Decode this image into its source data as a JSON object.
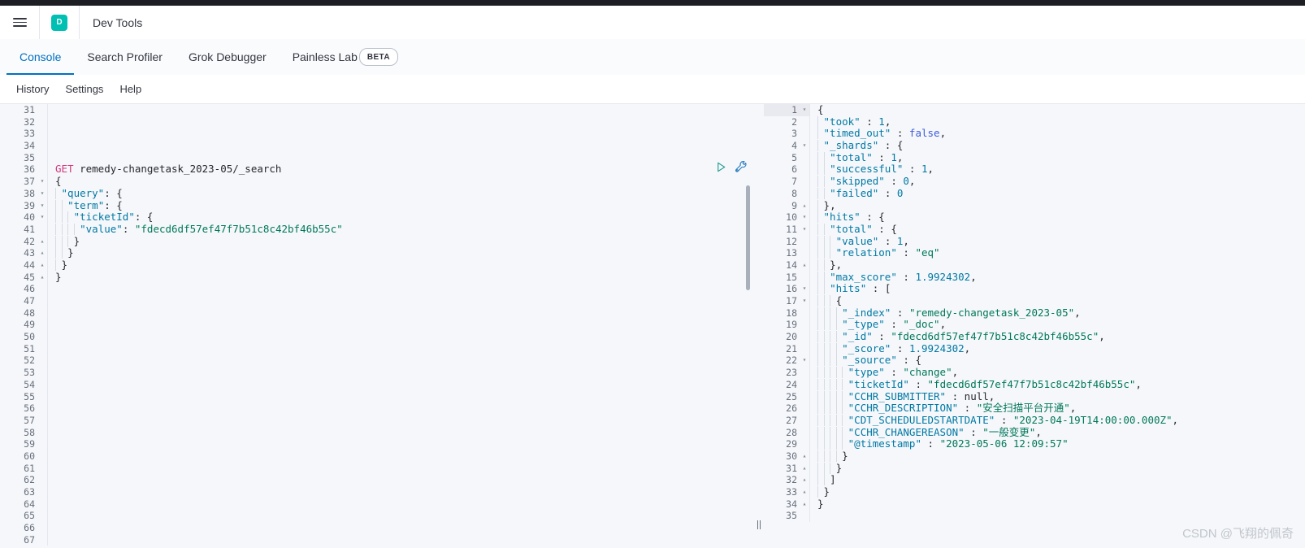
{
  "window": {
    "title": "Dev Tools",
    "logo_letter": "D",
    "logo_color": "#00bfb3",
    "accent_color": "#0071c2"
  },
  "header": {
    "menu_icon": "hamburger-icon"
  },
  "tabs": [
    {
      "label": "Console",
      "active": true
    },
    {
      "label": "Search Profiler",
      "active": false
    },
    {
      "label": "Grok Debugger",
      "active": false
    },
    {
      "label": "Painless Lab",
      "active": false,
      "badge": "BETA"
    }
  ],
  "subnav": [
    {
      "label": "History"
    },
    {
      "label": "Settings"
    },
    {
      "label": "Help"
    }
  ],
  "actions": {
    "send_request": "play-icon",
    "wrench": "wrench-icon"
  },
  "editor": {
    "first_visible_line": 31,
    "last_visible_line": 67,
    "request_line": 36,
    "lines": [
      {
        "n": 31,
        "fold": "",
        "tokens": []
      },
      {
        "n": 32,
        "fold": "",
        "tokens": []
      },
      {
        "n": 33,
        "fold": "",
        "tokens": []
      },
      {
        "n": 34,
        "fold": "",
        "tokens": []
      },
      {
        "n": 35,
        "fold": "",
        "tokens": []
      },
      {
        "n": 36,
        "fold": "",
        "text": "GET remedy-changetask_2023-05/_search"
      },
      {
        "n": 37,
        "fold": "▾",
        "text": "{"
      },
      {
        "n": 38,
        "fold": "▾",
        "text": "  \"query\": {"
      },
      {
        "n": 39,
        "fold": "▾",
        "text": "    \"term\": {"
      },
      {
        "n": 40,
        "fold": "▾",
        "text": "      \"ticketId\": {"
      },
      {
        "n": 41,
        "fold": "",
        "text": "        \"value\": \"fdecd6df57ef47f7b51c8c42bf46b55c\""
      },
      {
        "n": 42,
        "fold": "▴",
        "text": "      }"
      },
      {
        "n": 43,
        "fold": "▴",
        "text": "    }"
      },
      {
        "n": 44,
        "fold": "▴",
        "text": "  }"
      },
      {
        "n": 45,
        "fold": "▴",
        "text": "}"
      },
      {
        "n": 46,
        "fold": "",
        "text": ""
      },
      {
        "n": 47,
        "fold": "",
        "text": ""
      },
      {
        "n": 48,
        "fold": "",
        "text": ""
      },
      {
        "n": 49,
        "fold": "",
        "text": ""
      },
      {
        "n": 50,
        "fold": "",
        "text": ""
      },
      {
        "n": 51,
        "fold": "",
        "text": ""
      },
      {
        "n": 52,
        "fold": "",
        "text": ""
      },
      {
        "n": 53,
        "fold": "",
        "text": ""
      },
      {
        "n": 54,
        "fold": "",
        "text": ""
      },
      {
        "n": 55,
        "fold": "",
        "text": ""
      },
      {
        "n": 56,
        "fold": "",
        "text": ""
      },
      {
        "n": 57,
        "fold": "",
        "text": ""
      },
      {
        "n": 58,
        "fold": "",
        "text": ""
      },
      {
        "n": 59,
        "fold": "",
        "text": ""
      },
      {
        "n": 60,
        "fold": "",
        "text": ""
      },
      {
        "n": 61,
        "fold": "",
        "text": ""
      },
      {
        "n": 62,
        "fold": "",
        "text": ""
      },
      {
        "n": 63,
        "fold": "",
        "text": ""
      },
      {
        "n": 64,
        "fold": "",
        "text": ""
      },
      {
        "n": 65,
        "fold": "",
        "text": ""
      },
      {
        "n": 66,
        "fold": "",
        "text": ""
      },
      {
        "n": 67,
        "fold": "",
        "text": ""
      }
    ],
    "request": {
      "method": "GET",
      "path": "remedy-changetask_2023-05/_search",
      "body_keys": [
        "query",
        "term",
        "ticketId",
        "value"
      ],
      "ticket_id_value": "fdecd6df57ef47f7b51c8c42bf46b55c"
    }
  },
  "response": {
    "first_visible_line": 1,
    "last_visible_line": 35,
    "json": {
      "took": 1,
      "timed_out": false,
      "_shards": {
        "total": 1,
        "successful": 1,
        "skipped": 0,
        "failed": 0
      },
      "hits_total_value": 1,
      "hits_total_relation": "eq",
      "max_score": 1.9924302,
      "hit": {
        "_index": "remedy-changetask_2023-05",
        "_type": "_doc",
        "_id": "fdecd6df57ef47f7b51c8c42bf46b55c",
        "_score": 1.9924302,
        "_source": {
          "type": "change",
          "ticketId": "fdecd6df57ef47f7b51c8c42bf46b55c",
          "CCHR_SUBMITTER": null,
          "CCHR_DESCRIPTION": "安全扫描平台开通",
          "CDT_SCHEDULEDSTARTDATE": "2023-04-19T14:00:00.000Z",
          "CCHR_CHANGEREASON": "一般变更",
          "@timestamp": "2023-05-06 12:09:57"
        }
      }
    },
    "lines": [
      {
        "n": 1,
        "fold": "▾",
        "hl": true,
        "text": "{"
      },
      {
        "n": 2,
        "fold": "",
        "text": "  \"took\" : 1,"
      },
      {
        "n": 3,
        "fold": "",
        "text": "  \"timed_out\" : false,"
      },
      {
        "n": 4,
        "fold": "▾",
        "text": "  \"_shards\" : {"
      },
      {
        "n": 5,
        "fold": "",
        "text": "    \"total\" : 1,"
      },
      {
        "n": 6,
        "fold": "",
        "text": "    \"successful\" : 1,"
      },
      {
        "n": 7,
        "fold": "",
        "text": "    \"skipped\" : 0,"
      },
      {
        "n": 8,
        "fold": "",
        "text": "    \"failed\" : 0"
      },
      {
        "n": 9,
        "fold": "▴",
        "text": "  },"
      },
      {
        "n": 10,
        "fold": "▾",
        "text": "  \"hits\" : {"
      },
      {
        "n": 11,
        "fold": "▾",
        "text": "    \"total\" : {"
      },
      {
        "n": 12,
        "fold": "",
        "text": "      \"value\" : 1,"
      },
      {
        "n": 13,
        "fold": "",
        "text": "      \"relation\" : \"eq\""
      },
      {
        "n": 14,
        "fold": "▴",
        "text": "    },"
      },
      {
        "n": 15,
        "fold": "",
        "text": "    \"max_score\" : 1.9924302,"
      },
      {
        "n": 16,
        "fold": "▾",
        "text": "    \"hits\" : ["
      },
      {
        "n": 17,
        "fold": "▾",
        "text": "      {"
      },
      {
        "n": 18,
        "fold": "",
        "text": "        \"_index\" : \"remedy-changetask_2023-05\","
      },
      {
        "n": 19,
        "fold": "",
        "text": "        \"_type\" : \"_doc\","
      },
      {
        "n": 20,
        "fold": "",
        "text": "        \"_id\" : \"fdecd6df57ef47f7b51c8c42bf46b55c\","
      },
      {
        "n": 21,
        "fold": "",
        "text": "        \"_score\" : 1.9924302,"
      },
      {
        "n": 22,
        "fold": "▾",
        "text": "        \"_source\" : {"
      },
      {
        "n": 23,
        "fold": "",
        "text": "          \"type\" : \"change\","
      },
      {
        "n": 24,
        "fold": "",
        "text": "          \"ticketId\" : \"fdecd6df57ef47f7b51c8c42bf46b55c\","
      },
      {
        "n": 25,
        "fold": "",
        "text": "          \"CCHR_SUBMITTER\" : null,"
      },
      {
        "n": 26,
        "fold": "",
        "text": "          \"CCHR_DESCRIPTION\" : \"安全扫描平台开通\","
      },
      {
        "n": 27,
        "fold": "",
        "text": "          \"CDT_SCHEDULEDSTARTDATE\" : \"2023-04-19T14:00:00.000Z\","
      },
      {
        "n": 28,
        "fold": "",
        "text": "          \"CCHR_CHANGEREASON\" : \"一般变更\","
      },
      {
        "n": 29,
        "fold": "",
        "text": "          \"@timestamp\" : \"2023-05-06 12:09:57\""
      },
      {
        "n": 30,
        "fold": "▴",
        "text": "        }"
      },
      {
        "n": 31,
        "fold": "▴",
        "text": "      }"
      },
      {
        "n": 32,
        "fold": "▴",
        "text": "    ]"
      },
      {
        "n": 33,
        "fold": "▴",
        "text": "  }"
      },
      {
        "n": 34,
        "fold": "▴",
        "text": "}"
      },
      {
        "n": 35,
        "fold": "",
        "text": ""
      }
    ]
  },
  "watermark": "CSDN @飞翔的佩奇"
}
